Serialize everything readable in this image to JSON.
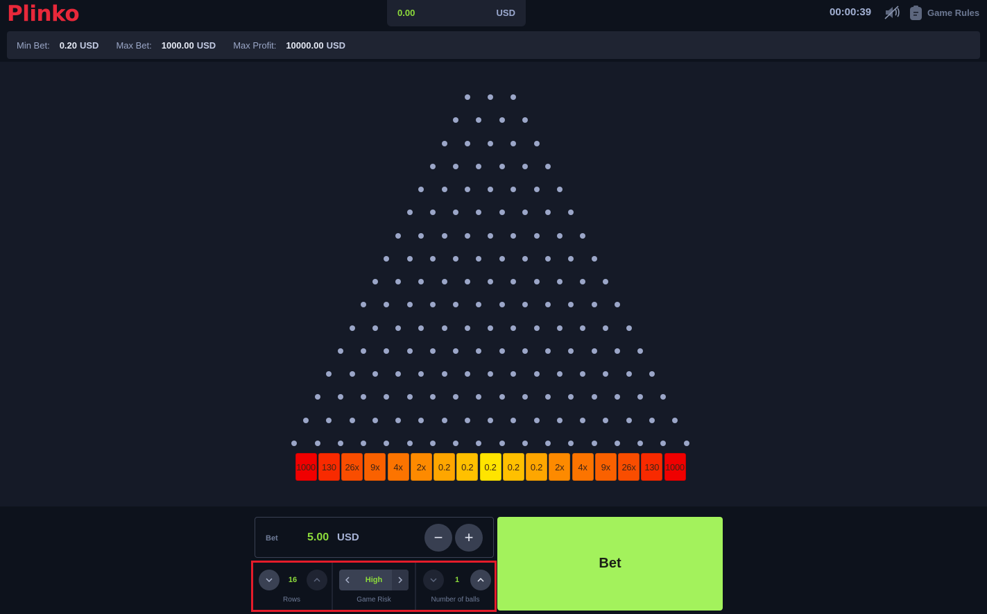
{
  "header": {
    "logo": "Plinko",
    "balance": {
      "amount": "0.00",
      "currency": "USD"
    },
    "timer": "00:00:39",
    "sound_icon": "sound-muted-icon",
    "rules_icon": "clipboard-icon",
    "rules_label": "Game Rules"
  },
  "limits": [
    {
      "label": "Min Bet:",
      "value": "0.20",
      "currency": "USD"
    },
    {
      "label": "Max Bet:",
      "value": "1000.00",
      "currency": "USD"
    },
    {
      "label": "Max Profit:",
      "value": "10000.00",
      "currency": "USD"
    }
  ],
  "board": {
    "rows": 16,
    "first_row_pegs": 3,
    "peg_color": "#9ba6c8",
    "multipliers": [
      "1000",
      "130",
      "26x",
      "9x",
      "4x",
      "2x",
      "0.2",
      "0.2",
      "0.2",
      "0.2",
      "0.2",
      "2x",
      "4x",
      "9x",
      "26x",
      "130",
      "1000"
    ],
    "bucket_colors": [
      "#f00000",
      "#f82a00",
      "#f94d00",
      "#fa6100",
      "#fc7400",
      "#fd8a00",
      "#fea600",
      "#ffc000",
      "#ffe400",
      "#ffc000",
      "#fea600",
      "#fd8a00",
      "#fc7400",
      "#fa6100",
      "#f94d00",
      "#f82a00",
      "#f00000"
    ]
  },
  "bet": {
    "label": "Bet",
    "amount": "5.00",
    "currency": "USD",
    "minus": "−",
    "plus": "+"
  },
  "controls": {
    "rows": {
      "value": "16",
      "label": "Rows"
    },
    "risk": {
      "value": "High",
      "label": "Game Risk"
    },
    "balls": {
      "value": "1",
      "label": "Number of balls"
    }
  },
  "bet_button": "Bet",
  "colors": {
    "accent_green": "#a3f25c",
    "value_green": "#8ddc3b",
    "brand_red": "#e8283a",
    "highlight_border": "#e41c2a"
  }
}
